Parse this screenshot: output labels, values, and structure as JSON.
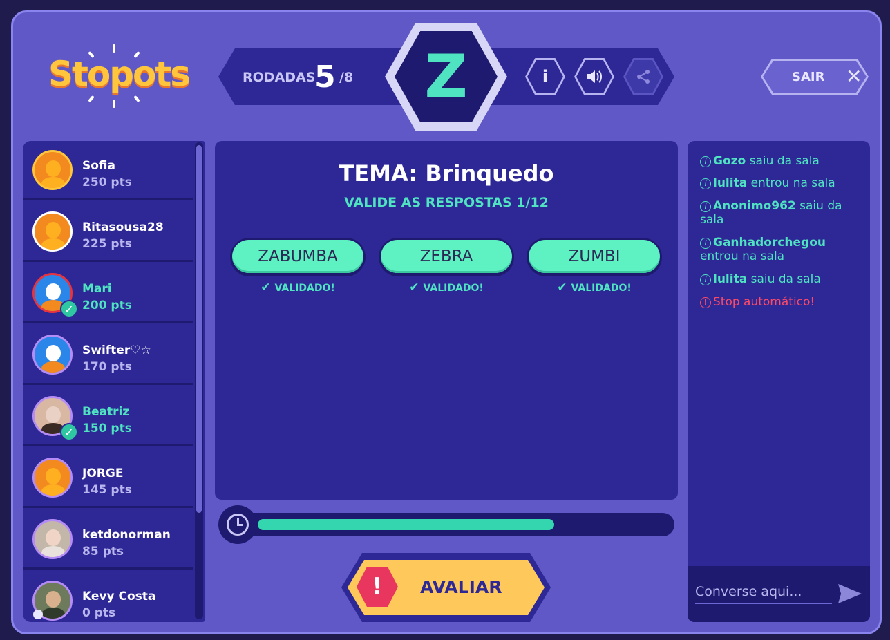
{
  "app": {
    "logo_text": "Stopots"
  },
  "round": {
    "label": "RODADAS",
    "current": "5",
    "total": "/8",
    "letter": "Z"
  },
  "header": {
    "exit_label": "SAIR"
  },
  "players": [
    {
      "name": "Sofia",
      "points": "250 pts",
      "validated": false
    },
    {
      "name": "Ritasousa28",
      "points": "225 pts",
      "validated": false
    },
    {
      "name": "Mari",
      "points": "200 pts",
      "validated": true
    },
    {
      "name": "Swifter♡☆",
      "points": "170 pts",
      "validated": false
    },
    {
      "name": "Beatriz",
      "points": "150 pts",
      "validated": true
    },
    {
      "name": "JORGE",
      "points": "145 pts",
      "validated": false
    },
    {
      "name": "ketdonorman",
      "points": "85 pts",
      "validated": false
    },
    {
      "name": "Kevy Costa",
      "points": "0 pts",
      "validated": false
    }
  ],
  "main": {
    "theme": "TEMA: Brinquedo",
    "subtitle": "VALIDE AS RESPOSTAS 1/12",
    "answers": [
      {
        "word": "ZABUMBA",
        "status": "VALIDADO!"
      },
      {
        "word": "ZEBRA",
        "status": "VALIDADO!"
      },
      {
        "word": "ZUMBI",
        "status": "VALIDADO!"
      }
    ],
    "timer_progress": 0.72,
    "evaluate_label": "AVALIAR"
  },
  "chat": {
    "messages": [
      {
        "user": "Gozo",
        "text": "saiu da sala"
      },
      {
        "user": "lulita",
        "text": "entrou na sala"
      },
      {
        "user": "Anonimo962",
        "text": "saiu da sala"
      },
      {
        "user": "Ganhadorchegou",
        "text": "entrou na sala"
      },
      {
        "user": "lulita",
        "text": "saiu da sala"
      },
      {
        "user": "",
        "text": "Stop automático!"
      }
    ],
    "input_placeholder": "Converse aqui..."
  },
  "colors": {
    "background": "#5f58c6",
    "panel": "#2d2895",
    "accent": "#4fe3c1",
    "alert": "#ff4a66",
    "button": "#ffc85a"
  }
}
